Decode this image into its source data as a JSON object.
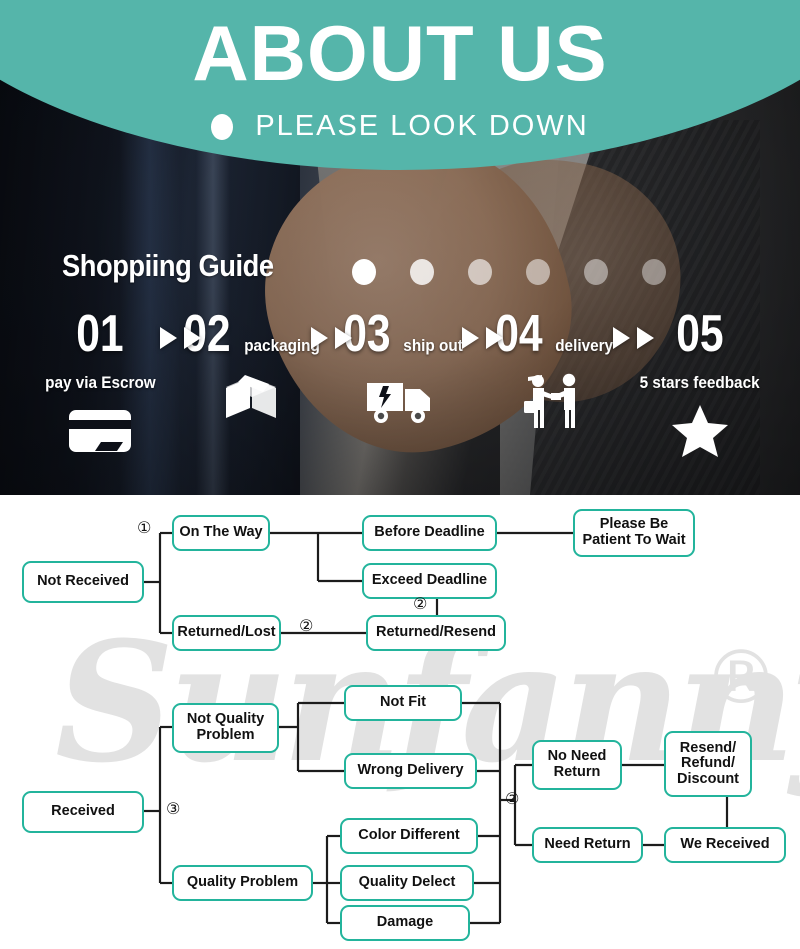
{
  "header": {
    "title": "ABOUT US",
    "subtitle": "PLEASE LOOK DOWN",
    "bullet_icon": "dot-icon",
    "accent_color": "#55b5aa"
  },
  "guide": {
    "title": "Shoppiing Guide",
    "dot_count": 6,
    "arrow_icon": "double-triangle-right-icon",
    "steps": [
      {
        "num": "01",
        "label": "pay via Escrow",
        "icon": "credit-card-icon"
      },
      {
        "num": "02",
        "label": "packaging",
        "icon": "box-package-icon"
      },
      {
        "num": "03",
        "label": "ship out",
        "icon": "delivery-truck-icon"
      },
      {
        "num": "04",
        "label": "delivery",
        "icon": "handover-people-icon"
      },
      {
        "num": "05",
        "label": "5 stars feedback",
        "icon": "star-icon"
      }
    ]
  },
  "flowchart": {
    "watermark": "Sunfanny",
    "watermark_mark": "®",
    "border_color": "#23b49c",
    "markers": [
      "①",
      "②",
      "③"
    ],
    "nodes": {
      "not_received": "Not Received",
      "on_the_way": "On The Way",
      "returned_lost": "Returned/Lost",
      "before_deadline": "Before Deadline",
      "exceed_deadline": "Exceed Deadline",
      "returned_resend": "Returned/Resend",
      "please_be_patient": "Please Be\nPatient To Wait",
      "received": "Received",
      "not_quality_problem": "Not Quality\nProblem",
      "quality_problem": "Quality Problem",
      "not_fit": "Not Fit",
      "wrong_delivery": "Wrong Delivery",
      "color_different": "Color Different",
      "quality_delect": "Quality Delect",
      "damage": "Damage",
      "no_need_return": "No Need\nReturn",
      "need_return": "Need Return",
      "resend_refund_discount": "Resend/\nRefund/\nDiscount",
      "we_received": "We Received"
    },
    "marker_labels": {
      "m1": "①",
      "m2a": "②",
      "m2b": "②",
      "m3": "③",
      "m2c": "②"
    }
  }
}
